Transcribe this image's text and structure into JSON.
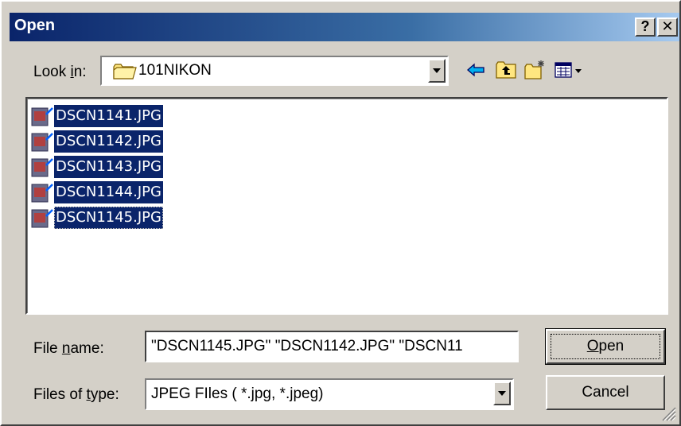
{
  "window": {
    "title": "Open",
    "help_label": "?",
    "close_label": "✕"
  },
  "lookin": {
    "label_pre": "Look ",
    "label_key": "i",
    "label_post": "n:",
    "value": "101NIKON"
  },
  "toolbar": {
    "icons": [
      "back-arrow-icon",
      "up-folder-icon",
      "new-folder-icon",
      "view-menu-icon"
    ]
  },
  "files": [
    {
      "name": "DSCN1141.JPG",
      "selected": true
    },
    {
      "name": "DSCN1142.JPG",
      "selected": true
    },
    {
      "name": "DSCN1143.JPG",
      "selected": true
    },
    {
      "name": "DSCN1144.JPG",
      "selected": true
    },
    {
      "name": "DSCN1145.JPG",
      "selected": true,
      "focused": true
    }
  ],
  "filename": {
    "label_pre": "File ",
    "label_key": "n",
    "label_post": "ame:",
    "value": "\"DSCN1145.JPG\" \"DSCN1142.JPG\" \"DSCN11"
  },
  "filetype": {
    "label_pre": "Files of ",
    "label_key": "t",
    "label_post": "ype:",
    "value": "JPEG FIles ( *.jpg, *.jpeg)"
  },
  "buttons": {
    "open_key": "O",
    "open_rest": "pen",
    "cancel": "Cancel"
  },
  "colors": {
    "selection": "#0a246a",
    "face": "#d4d0c8",
    "titlebar_start": "#0a246a",
    "titlebar_end": "#a6caf0"
  }
}
